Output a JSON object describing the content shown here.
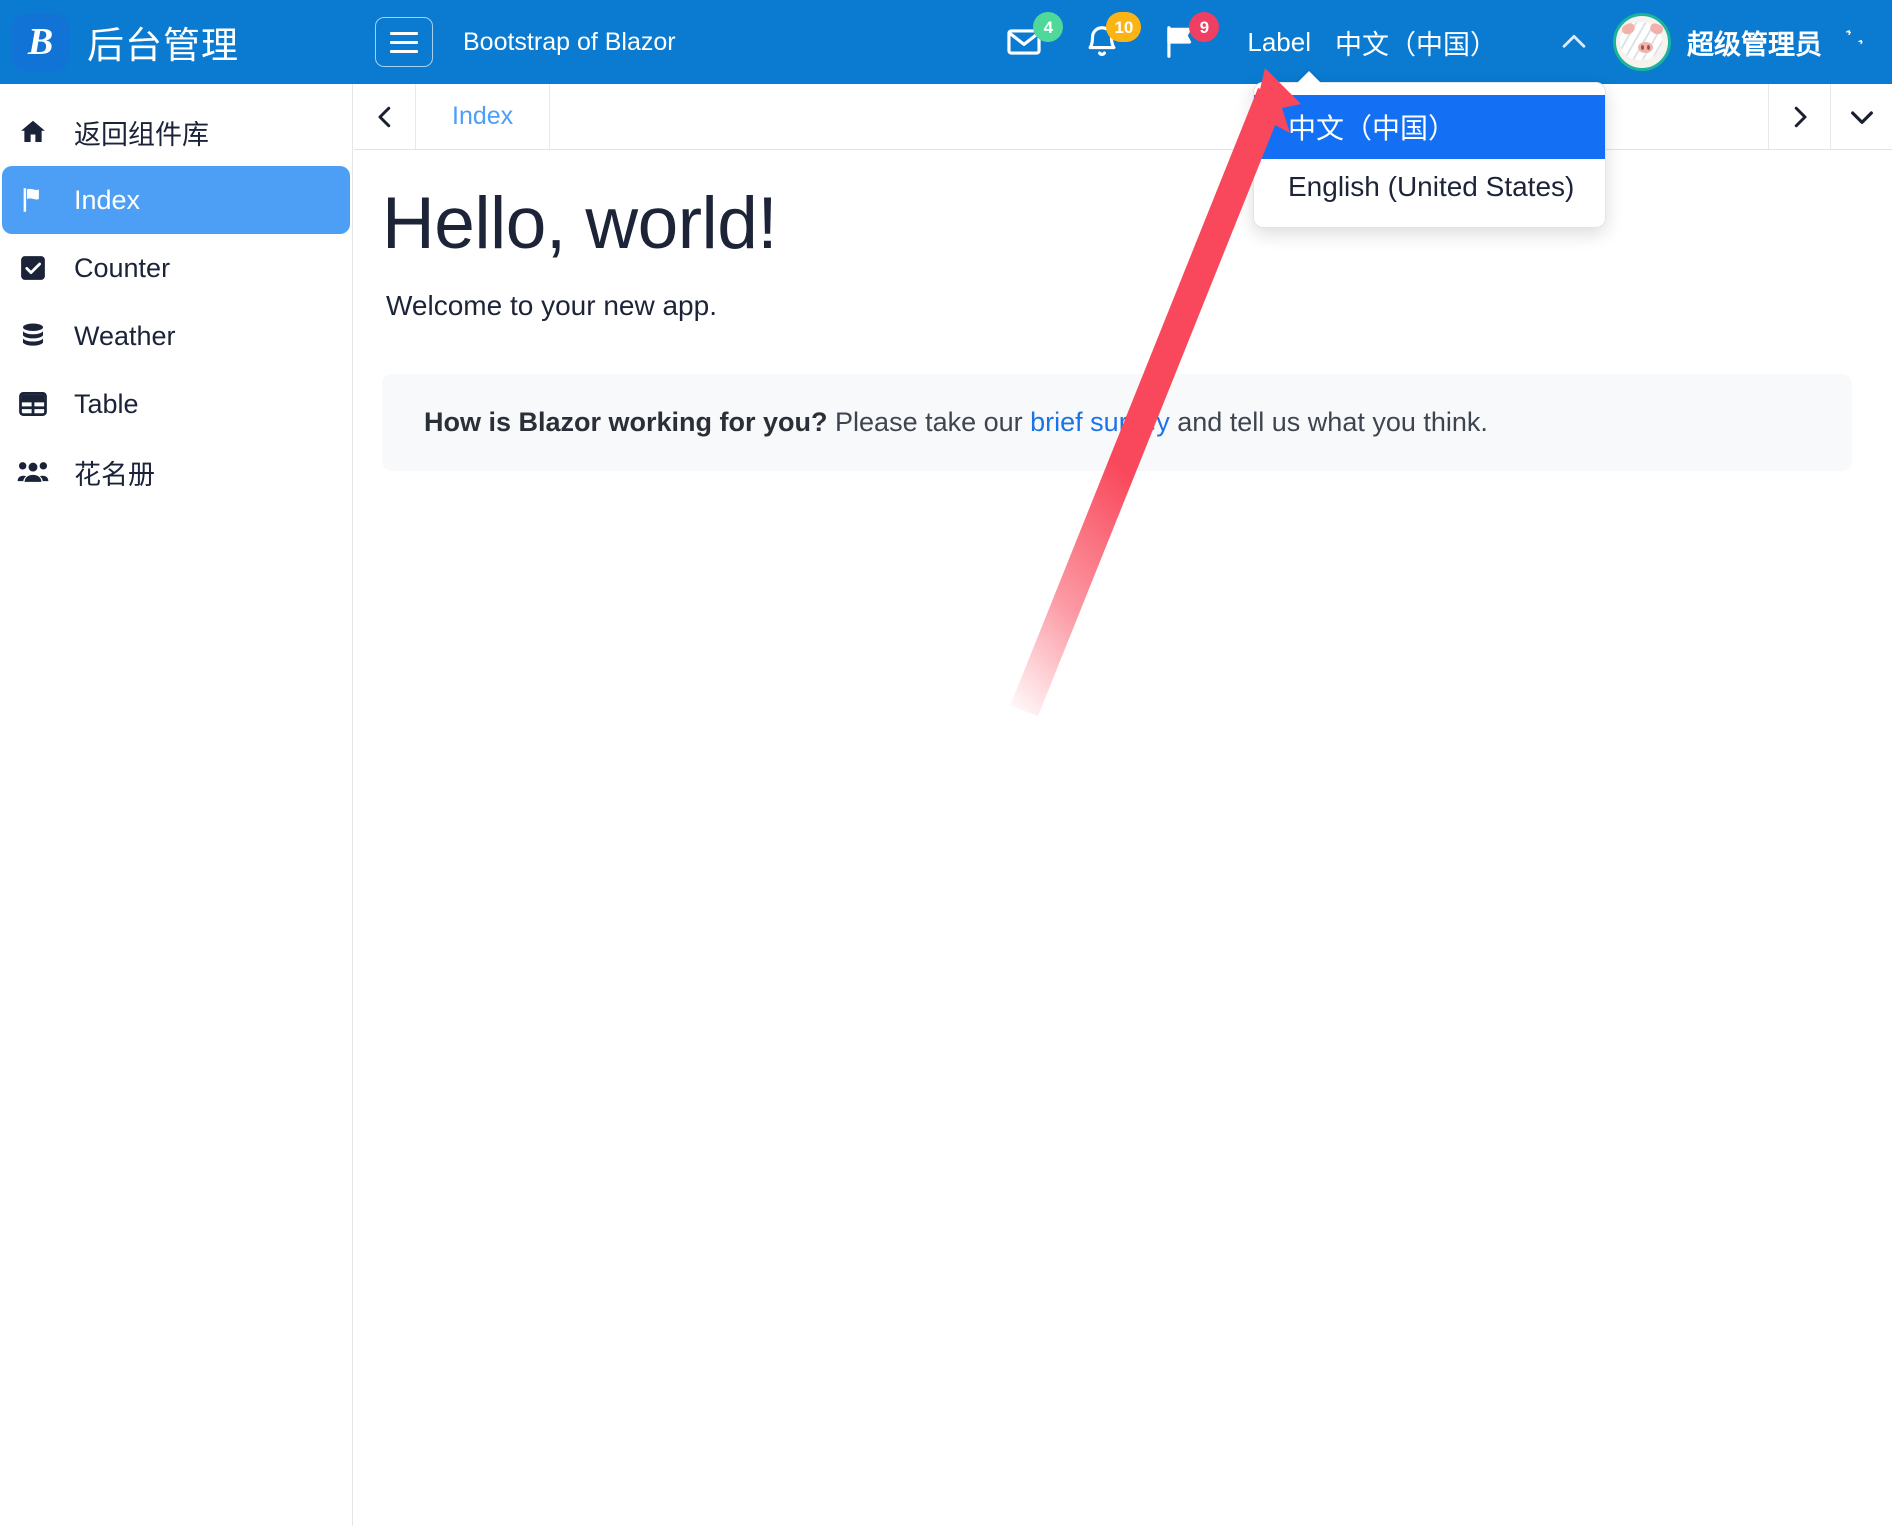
{
  "header": {
    "brand_logo_glyph": "B",
    "brand_title": "后台管理",
    "app_title": "Bootstrap of Blazor",
    "hamburger_icon": "hamburger-menu-icon",
    "icons": [
      {
        "name": "mail-icon",
        "badge": "4",
        "color": "#4ed89a"
      },
      {
        "name": "bell-icon",
        "badge": "10",
        "color": "#fcb414"
      },
      {
        "name": "flag-icon",
        "badge": "9",
        "color": "#ef3f63"
      }
    ],
    "label_text": "Label",
    "language_text": "中文（中国）",
    "collapse_icon": "chevron-up-icon",
    "user_name": "超级管理员",
    "settings_icon": "gears-icon",
    "avatar_icon": "user-avatar"
  },
  "language_dropdown": {
    "options": [
      {
        "label": "中文（中国）",
        "selected": true
      },
      {
        "label": "English (United States)",
        "selected": false
      }
    ]
  },
  "sidebar": {
    "items": [
      {
        "label": "返回组件库",
        "icon": "home-icon",
        "active": false
      },
      {
        "label": "Index",
        "icon": "flag-icon",
        "active": true
      },
      {
        "label": "Counter",
        "icon": "checkbox-icon",
        "active": false
      },
      {
        "label": "Weather",
        "icon": "database-icon",
        "active": false
      },
      {
        "label": "Table",
        "icon": "table-icon",
        "active": false
      },
      {
        "label": "花名册",
        "icon": "people-icon",
        "active": false
      }
    ]
  },
  "tabbar": {
    "prev_icon": "chevron-left-icon",
    "next_icon": "chevron-right-icon",
    "dropdown_icon": "chevron-down-icon",
    "tabs": [
      {
        "label": "Index",
        "active": true
      }
    ]
  },
  "main": {
    "heading": "Hello, world!",
    "subtitle": "Welcome to your new app.",
    "survey": {
      "bold_text": "How is Blazor working for you?",
      "text_before": " Please take our ",
      "link_text": "brief survey",
      "text_after": " and tell us what you think."
    }
  },
  "annotation": {
    "arrow_color": "#f9485b",
    "points_to": "中文（中国）"
  },
  "colors": {
    "header_blue": "#0a7bd0",
    "sidebar_active": "#4d9ef5",
    "dropdown_selected": "#1370f4",
    "link_blue": "#1a73e8",
    "text_dark": "#1d2438"
  }
}
